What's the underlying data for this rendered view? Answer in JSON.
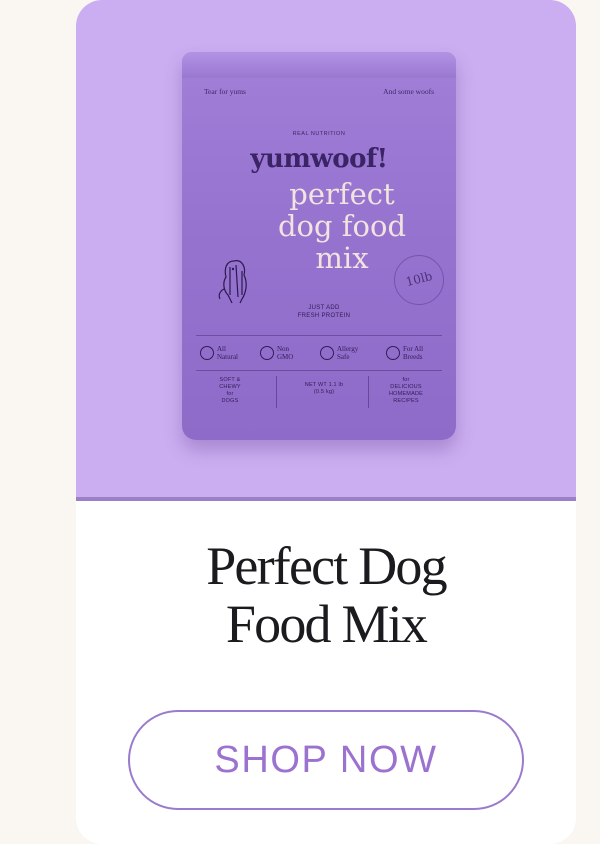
{
  "product_bag": {
    "top_left_text": "Tear for yums",
    "top_right_text": "And some woofs",
    "tagline": "REAL NUTRITION",
    "brand": "yumwoof!",
    "name_lines": [
      "perfect",
      "dog food",
      "mix"
    ],
    "subtext_lines": [
      "JUST ADD",
      "FRESH PROTEIN"
    ],
    "stamp_text": "10lb",
    "features": [
      {
        "icon": "leaf-icon",
        "label_lines": [
          "All",
          "Natural"
        ]
      },
      {
        "icon": "no-gmo-icon",
        "label_lines": [
          "Non",
          "GMO"
        ]
      },
      {
        "icon": "heart-icon",
        "label_lines": [
          "Allergy",
          "Safe"
        ]
      },
      {
        "icon": "dog-icon",
        "label_lines": [
          "For All",
          "Breeds"
        ]
      }
    ],
    "info_items": [
      {
        "lines": [
          "SOFT &",
          "CHEWY",
          "for",
          "DOGS"
        ]
      },
      {
        "lines": [
          "NET WT 1.1 lb",
          "(0.5 kg)"
        ]
      },
      {
        "lines": [
          "for",
          "DELICIOUS",
          "HOMEMADE",
          "RECIPES"
        ]
      }
    ]
  },
  "product": {
    "title_lines": [
      "Perfect Dog",
      "Food Mix"
    ]
  },
  "cta": {
    "label": "SHOP NOW"
  },
  "colors": {
    "hero_background": "#cbaef1",
    "bag": "#9573cf",
    "accent": "#9b72cf",
    "page_background": "#faf7f2"
  }
}
